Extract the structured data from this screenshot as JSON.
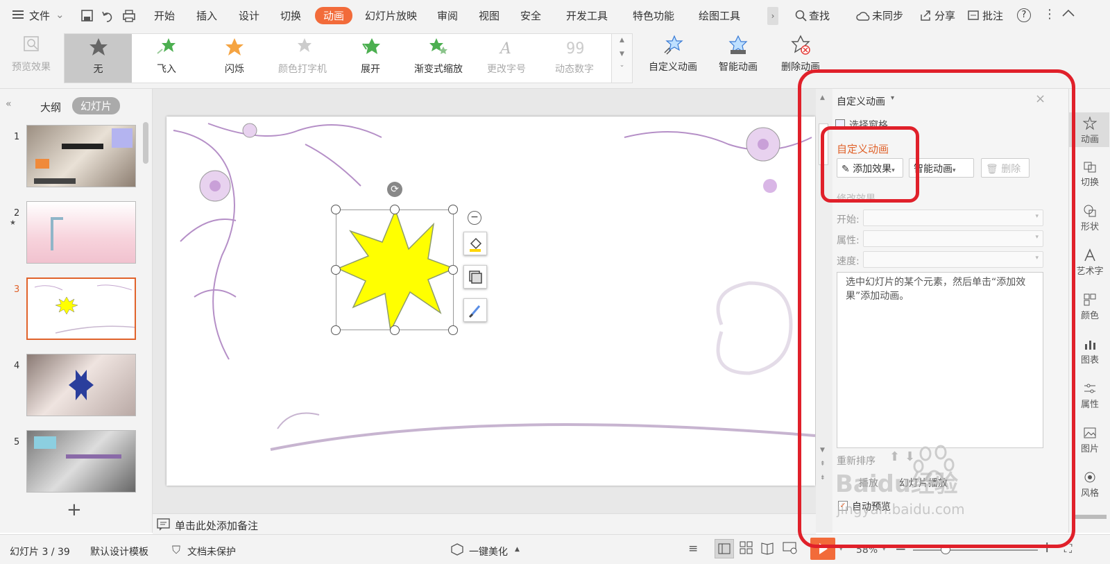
{
  "menubar": {
    "file_label": "文件",
    "tabs": [
      "开始",
      "插入",
      "设计",
      "切换",
      "动画",
      "幻灯片放映",
      "审阅",
      "视图",
      "安全",
      "开发工具",
      "特色功能",
      "绘图工具"
    ],
    "active_tab": "动画",
    "search_label": "查找",
    "sync_label": "未同步",
    "share_label": "分享",
    "comment_label": "批注"
  },
  "ribbon": {
    "preview_label": "预览效果",
    "effects": [
      "无",
      "飞入",
      "闪烁",
      "颜色打字机",
      "展开",
      "渐变式缩放",
      "更改字号",
      "动态数字"
    ],
    "custom_anim_label": "自定义动画",
    "smart_anim_label": "智能动画",
    "delete_anim_label": "删除动画"
  },
  "leftpanel": {
    "tab_outline": "大纲",
    "tab_slides": "幻灯片",
    "slide_numbers": [
      "1",
      "2",
      "3",
      "4",
      "5"
    ],
    "add_icon": "plus-icon"
  },
  "notes": {
    "placeholder": "单击此处添加备注"
  },
  "pane": {
    "header": "自定义动画",
    "select_pane": "选择窗格",
    "section_title": "自定义动画",
    "add_effect": "添加效果",
    "smart_anim": "智能动画",
    "delete": "删除",
    "modify_title": "修改效果",
    "start_label": "开始:",
    "property_label": "属性:",
    "speed_label": "速度:",
    "hint": "选中幻灯片的某个元素，然后单击“添加效果”添加动画。",
    "reorder": "重新排序",
    "play": "播放",
    "slideshow": "幻灯片播放",
    "auto_preview": "自动预览"
  },
  "sidebar": {
    "items": [
      "动画",
      "切换",
      "形状",
      "艺术字",
      "颜色",
      "图表",
      "属性",
      "图片",
      "风格"
    ]
  },
  "status": {
    "slide_info": "幻灯片 3 / 39",
    "template": "默认设计模板",
    "protect": "文档未保护",
    "beautify": "一键美化",
    "zoom": "58%"
  },
  "watermark": {
    "line1": "Baidu经验",
    "line2": "jingyan.baidu.com"
  },
  "colors": {
    "accent": "#f26b3a",
    "highlight_red": "#e0202a",
    "star_fill": "#ffff00"
  }
}
